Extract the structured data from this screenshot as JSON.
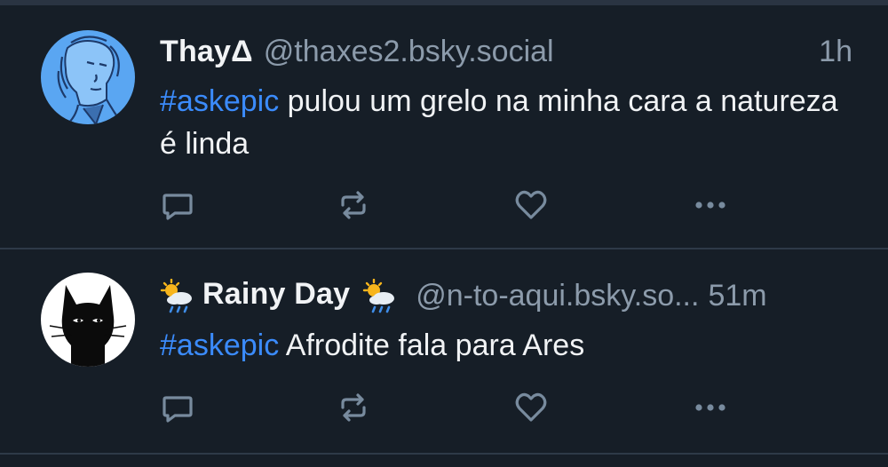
{
  "posts": [
    {
      "display_name": "ThayΔ",
      "handle": "@thaxes2.bsky.social",
      "time": "1h",
      "hashtag": "#askepic",
      "text": " pulou um grelo na minha cara a natureza é linda",
      "avatar_icon": "sketch-portrait-avatar",
      "actions": [
        "reply-icon",
        "repost-icon",
        "like-icon",
        "more-options-icon"
      ]
    },
    {
      "display_name": "Rainy Day",
      "name_emoji": "sun-behind-rain-cloud",
      "handle": "@n-to-aqui.bsky.so...",
      "time": "51m",
      "hashtag": "#askepic",
      "text": " Afrodite fala para Ares",
      "avatar_icon": "black-cat-avatar",
      "actions": [
        "reply-icon",
        "repost-icon",
        "like-icon",
        "more-options-icon"
      ]
    }
  ],
  "colors": {
    "background": "#161e27",
    "text": "#f1f3f5",
    "muted": "#8c9bab",
    "hashtag": "#3b8bfb",
    "icon": "#788b9e"
  }
}
